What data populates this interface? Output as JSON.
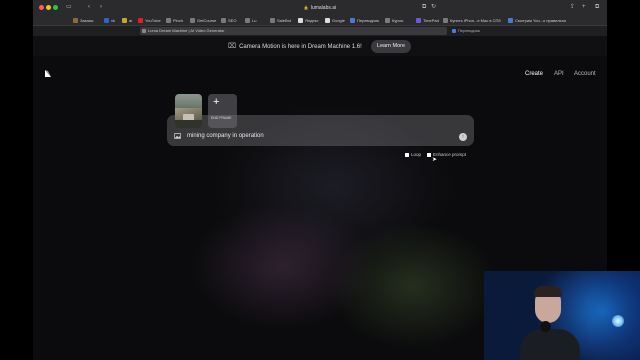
{
  "browser": {
    "address": "lumalabs.ai",
    "bookmarks": [
      "Заказы",
      "vk",
      "ai",
      "YouTube",
      "Pinch",
      "GetCourse",
      "SEO",
      "Lu",
      "SaleBot",
      "Яндекс",
      "Google",
      "Переводчик",
      "Курсы",
      "TimePad",
      "Купить iPhon...e Mac в СПб",
      "Смотрим You...о правильно"
    ],
    "tabs": [
      {
        "label": "Luma Dream Machine | AI Video Generator",
        "active": true
      },
      {
        "label": "Переводчик",
        "active": false
      }
    ]
  },
  "banner": {
    "text": "Camera Motion is here in Dream Machine 1.6!",
    "button_label": "Learn More"
  },
  "nav": {
    "create": "Create",
    "api": "API",
    "account": "Account"
  },
  "composer": {
    "end_frame_label": "END FRAME",
    "prompt_value": "mining company in operation",
    "send_icon": "arrow-up-icon"
  },
  "options": {
    "loop_label": "Loop",
    "enhance_label": "Enhance prompt"
  },
  "colors": {
    "page_bg": "#0b0b0d",
    "prompt_bg": "#6e6e73",
    "cam_accent": "#1a6fc6"
  }
}
